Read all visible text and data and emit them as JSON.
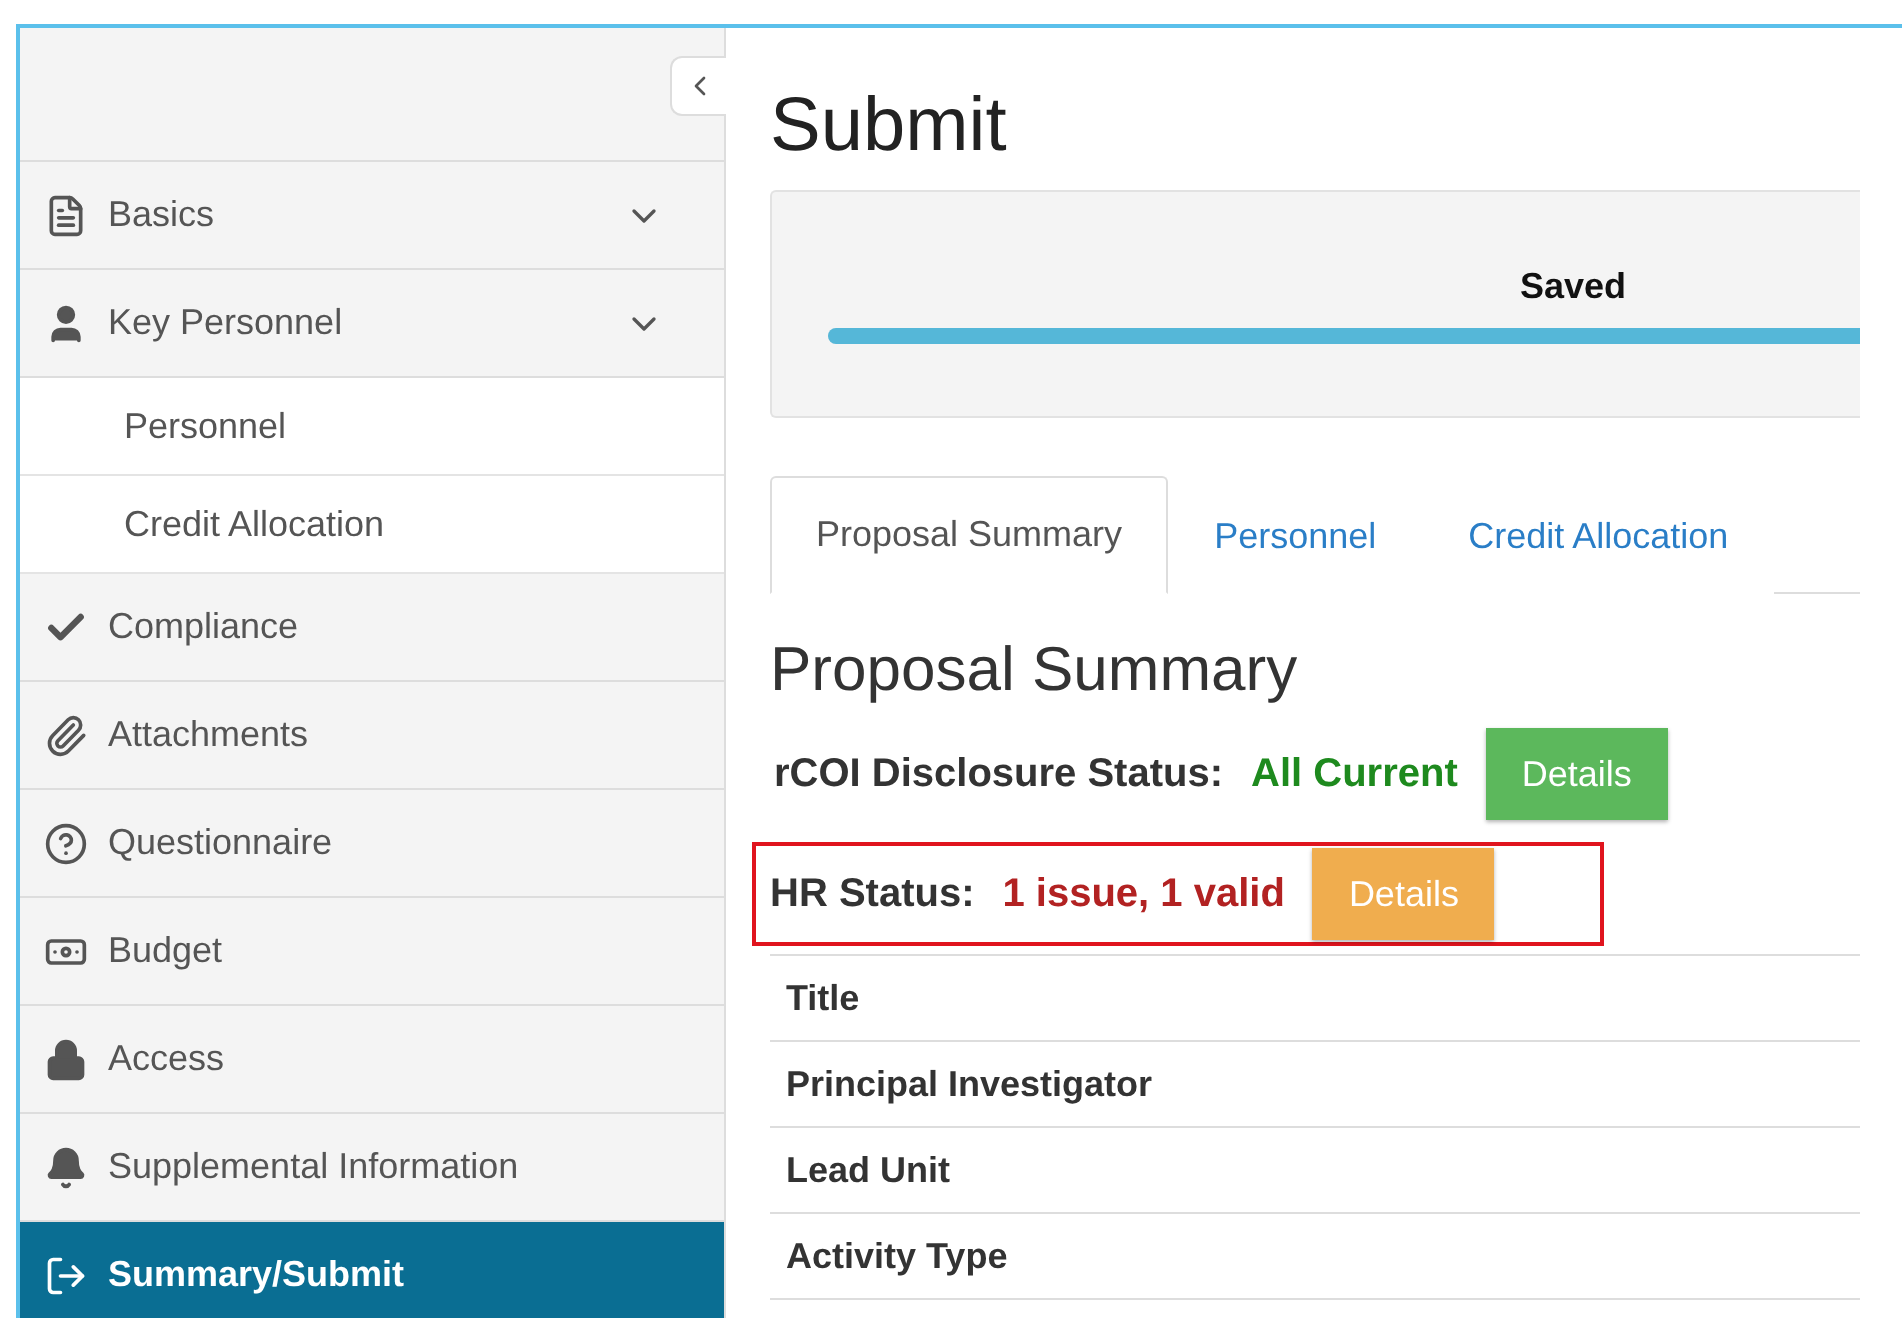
{
  "sidebar": {
    "items": [
      {
        "label": "Basics",
        "kind": "group",
        "selected": false
      },
      {
        "label": "Key Personnel",
        "kind": "group",
        "selected": false,
        "children": [
          {
            "label": "Personnel",
            "selected": false
          },
          {
            "label": "Credit Allocation",
            "selected": false
          }
        ]
      },
      {
        "label": "Compliance",
        "kind": "link",
        "selected": false
      },
      {
        "label": "Attachments",
        "kind": "link",
        "selected": false
      },
      {
        "label": "Questionnaire",
        "kind": "link",
        "selected": false
      },
      {
        "label": "Budget",
        "kind": "link",
        "selected": false
      },
      {
        "label": "Access",
        "kind": "link",
        "selected": false
      },
      {
        "label": "Supplemental Information",
        "kind": "link",
        "selected": false
      },
      {
        "label": "Summary/Submit",
        "kind": "link",
        "selected": true
      }
    ]
  },
  "page": {
    "title": "Submit",
    "progress": {
      "label": "Saved",
      "level": 1
    },
    "tabs": [
      {
        "label": "Proposal Summary",
        "selected": true
      },
      {
        "label": "Personnel",
        "selected": false
      },
      {
        "label": "Credit Allocation",
        "selected": false
      }
    ],
    "heading": "Proposal Summary",
    "statuses": [
      {
        "label": "rCOI Disclosure Status:",
        "value": "All Current",
        "color": "#1e8a1e",
        "button": "Details",
        "kind": "success",
        "highlighted": false
      },
      {
        "label": "HR Status:",
        "value": "1 issue, 1 valid",
        "color": "#b22222",
        "button": "Details",
        "kind": "warning",
        "highlighted": true
      }
    ],
    "table": {
      "rows": [
        "Title",
        "Principal Investigator",
        "Lead Unit",
        "Activity Type"
      ]
    }
  }
}
